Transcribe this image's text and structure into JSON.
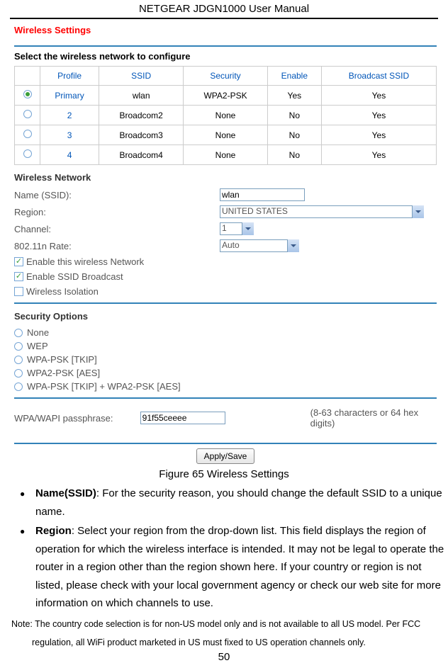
{
  "header": "NETGEAR JDGN1000 User Manual",
  "pageTitle": "Wireless Settings",
  "selectLabel": "Select the wireless network to configure",
  "tableHeaders": [
    "",
    "Profile",
    "SSID",
    "Security",
    "Enable",
    "Broadcast SSID"
  ],
  "rows": [
    {
      "selected": true,
      "profile": "Primary",
      "ssid": "wlan",
      "security": "WPA2-PSK",
      "enable": "Yes",
      "broadcast": "Yes"
    },
    {
      "selected": false,
      "profile": "2",
      "ssid": "Broadcom2",
      "security": "None",
      "enable": "No",
      "broadcast": "Yes"
    },
    {
      "selected": false,
      "profile": "3",
      "ssid": "Broadcom3",
      "security": "None",
      "enable": "No",
      "broadcast": "Yes"
    },
    {
      "selected": false,
      "profile": "4",
      "ssid": "Broadcom4",
      "security": "None",
      "enable": "No",
      "broadcast": "Yes"
    }
  ],
  "wireless": {
    "title": "Wireless Network",
    "nameLabel": "Name (SSID):",
    "nameValue": "wlan",
    "regionLabel": "Region:",
    "regionValue": "UNITED STATES",
    "channelLabel": "Channel:",
    "channelValue": "1",
    "rateLabel": "802.11n Rate:",
    "rateValue": "Auto",
    "chkEnable": "Enable this wireless Network",
    "chkBroadcast": "Enable SSID Broadcast",
    "chkIsolation": "Wireless Isolation"
  },
  "security": {
    "title": "Security Options",
    "options": [
      "None",
      "WEP",
      "WPA-PSK [TKIP]",
      "WPA2-PSK [AES]",
      "WPA-PSK [TKIP] + WPA2-PSK [AES]"
    ],
    "passLabel": "WPA/WAPI passphrase:",
    "passValue": "91f55ceeee",
    "passHint": "(8-63 characters or 64 hex digits)"
  },
  "btnLabel": "Apply/Save",
  "caption": "Figure 65 Wireless Settings",
  "items": [
    {
      "bold": "Name(SSID)",
      "text": ": For the security reason, you should change the default SSID to a unique name."
    },
    {
      "bold": "Region",
      "text": ": Select your region from the drop-down list. This field displays the region of operation for which the wireless interface is intended. It may not be legal to operate the router in a region other than the region shown here. If your country or region is not listed, please check with your local government agency or check our web site for more information on which channels to use."
    }
  ],
  "note1": "Note: The country code selection is for non-US model only and is not available to all US model. Per FCC",
  "note2": "regulation, all WiFi product marketed in US must fixed to US operation channels only.",
  "pageNum": "50"
}
